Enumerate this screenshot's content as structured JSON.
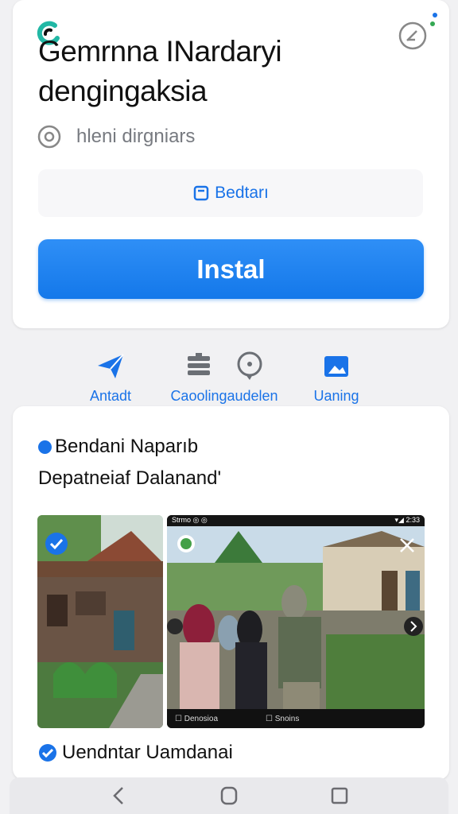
{
  "header": {
    "app_title": "Gemrnna INardaryi dengingaksia",
    "developer": "hleni dirgniars"
  },
  "buttons": {
    "wishlist_label": "Bedtarı",
    "install_label": "Instal"
  },
  "actions": [
    {
      "label": "Antadt",
      "icon": "send-icon"
    },
    {
      "label": "Caoolingaudelen",
      "icon": "list-bubble-icon"
    },
    {
      "label": "Uaning",
      "icon": "image-icon"
    }
  ],
  "section": {
    "title": "Bendani Naparıb",
    "subtitle": "Depatneiaf Dalanand'"
  },
  "screenshot2": {
    "status_left": "Strmo ◎ ◎",
    "status_right": "▾◢ 2:33",
    "bottom_left": "Denosioa",
    "bottom_right": "Snoins"
  },
  "footer": {
    "title": "Uendntar Uamdanai"
  },
  "colors": {
    "accent": "#1a73e8",
    "install": "#1478ea",
    "background": "#f1f1f3"
  }
}
